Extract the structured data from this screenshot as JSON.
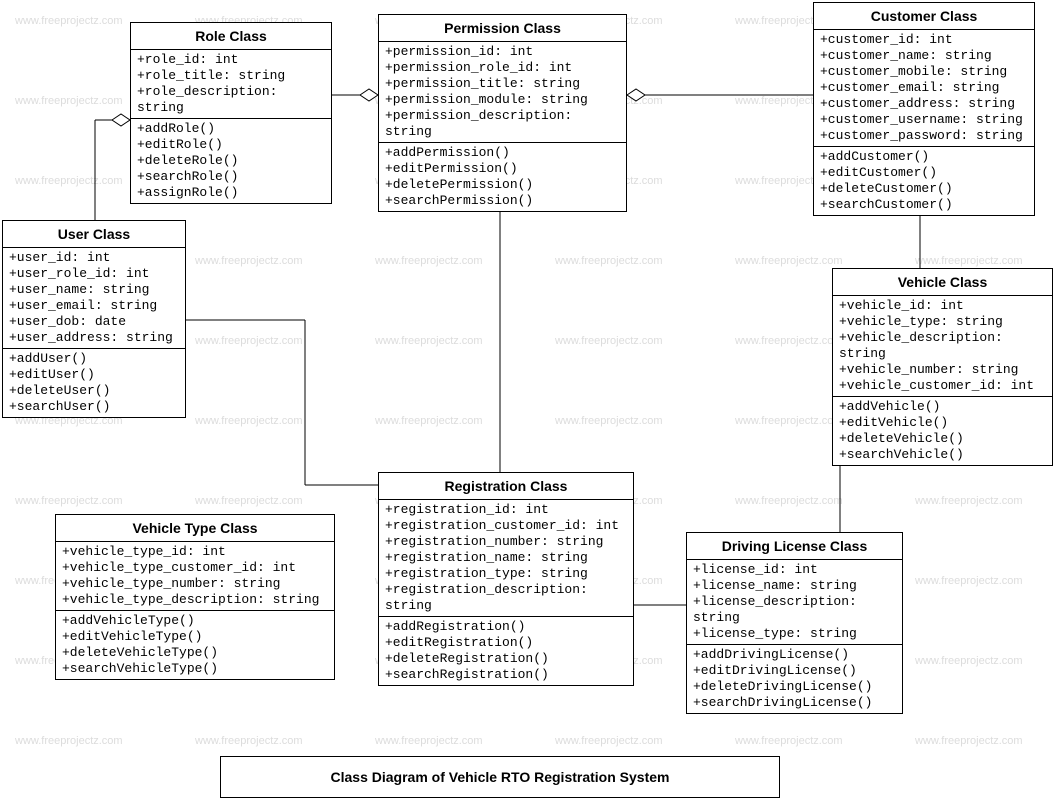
{
  "watermark": "www.freeprojectz.com",
  "caption": "Class Diagram of Vehicle RTO Registration System",
  "classes": {
    "role": {
      "title": "Role Class",
      "attrs": [
        "+role_id: int",
        "+role_title: string",
        "+role_description: string"
      ],
      "ops": [
        "+addRole()",
        "+editRole()",
        "+deleteRole()",
        "+searchRole()",
        "+assignRole()"
      ]
    },
    "permission": {
      "title": "Permission Class",
      "attrs": [
        "+permission_id: int",
        "+permission_role_id: int",
        "+permission_title: string",
        "+permission_module: string",
        "+permission_description: string"
      ],
      "ops": [
        "+addPermission()",
        "+editPermission()",
        "+deletePermission()",
        "+searchPermission()"
      ]
    },
    "customer": {
      "title": "Customer Class",
      "attrs": [
        "+customer_id: int",
        "+customer_name: string",
        "+customer_mobile: string",
        "+customer_email: string",
        "+customer_address: string",
        "+customer_username: string",
        "+customer_password: string"
      ],
      "ops": [
        "+addCustomer()",
        "+editCustomer()",
        "+deleteCustomer()",
        "+searchCustomer()"
      ]
    },
    "user": {
      "title": "User Class",
      "attrs": [
        "+user_id: int",
        "+user_role_id: int",
        "+user_name: string",
        "+user_email: string",
        "+user_dob: date",
        "+user_address: string"
      ],
      "ops": [
        "+addUser()",
        "+editUser()",
        "+deleteUser()",
        "+searchUser()"
      ]
    },
    "vehicle": {
      "title": "Vehicle Class",
      "attrs": [
        "+vehicle_id: int",
        "+vehicle_type: string",
        "+vehicle_description: string",
        "+vehicle_number: string",
        "+vehicle_customer_id: int"
      ],
      "ops": [
        "+addVehicle()",
        "+editVehicle()",
        "+deleteVehicle()",
        "+searchVehicle()"
      ]
    },
    "registration": {
      "title": "Registration  Class",
      "attrs": [
        "+registration_id: int",
        "+registration_customer_id: int",
        "+registration_number: string",
        "+registration_name: string",
        "+registration_type: string",
        "+registration_description: string"
      ],
      "ops": [
        "+addRegistration()",
        "+editRegistration()",
        "+deleteRegistration()",
        "+searchRegistration()"
      ]
    },
    "vehicle_type": {
      "title": "Vehicle Type Class",
      "attrs": [
        "+vehicle_type_id: int",
        "+vehicle_type_customer_id: int",
        "+vehicle_type_number: string",
        "+vehicle_type_description: string"
      ],
      "ops": [
        "+addVehicleType()",
        "+editVehicleType()",
        "+deleteVehicleType()",
        "+searchVehicleType()"
      ]
    },
    "driving_license": {
      "title": "Driving License Class",
      "attrs": [
        "+license_id: int",
        "+license_name: string",
        "+license_description: string",
        "+license_type: string"
      ],
      "ops": [
        "+addDrivingLicense()",
        "+editDrivingLicense()",
        "+deleteDrivingLicense()",
        "+searchDrivingLicense()"
      ]
    }
  }
}
